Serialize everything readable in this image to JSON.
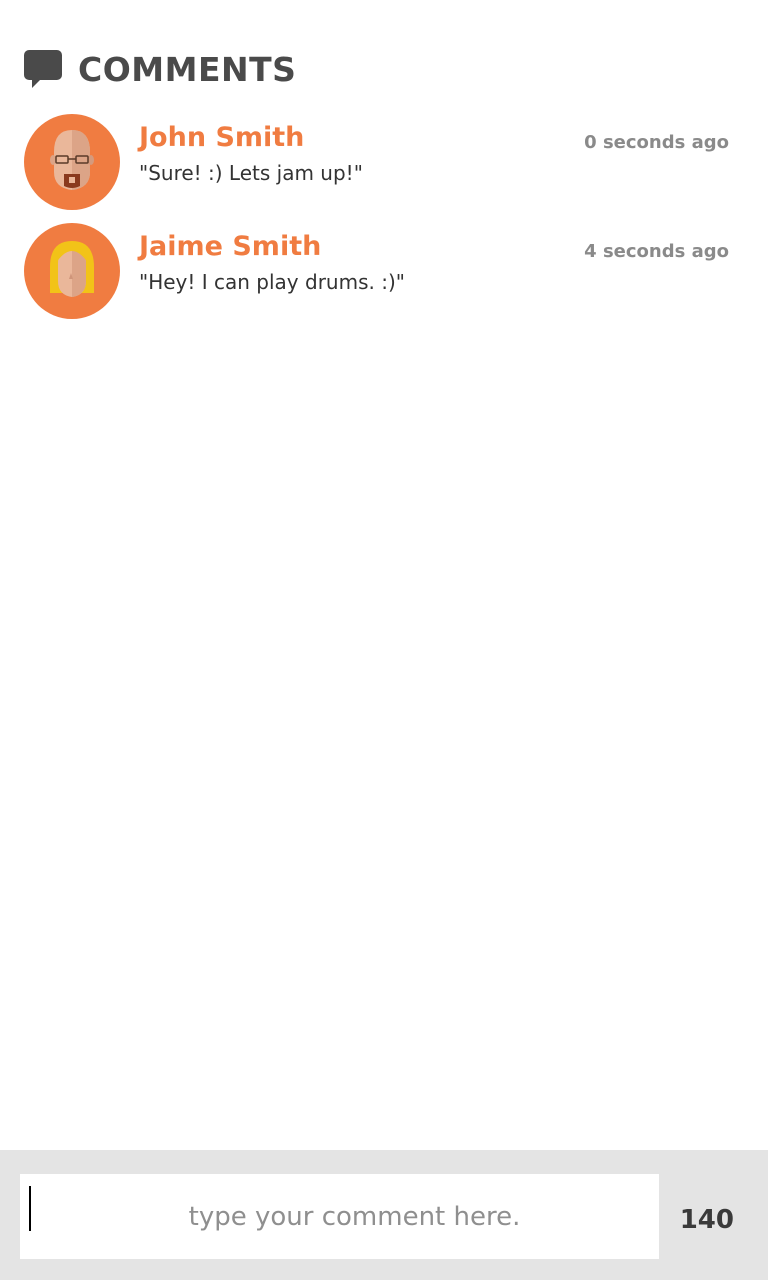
{
  "header": {
    "icon": "speech-bubble-icon",
    "title": "COMMENTS"
  },
  "comments": [
    {
      "name": "John Smith",
      "time": "0 seconds ago",
      "text": "\"Sure! :) Lets jam up!\"",
      "avatar": "bald-man-glasses-goatee-avatar"
    },
    {
      "name": "Jaime Smith",
      "time": "4 seconds ago",
      "text": "\"Hey! I can play drums. :)\"",
      "avatar": "blonde-woman-avatar"
    }
  ],
  "composer": {
    "placeholder": "type your comment here.",
    "value": "",
    "char_count": "140"
  },
  "colors": {
    "accent": "#f07c41",
    "header_text": "#4a4a4a",
    "footer_bg": "#e4e4e4"
  }
}
